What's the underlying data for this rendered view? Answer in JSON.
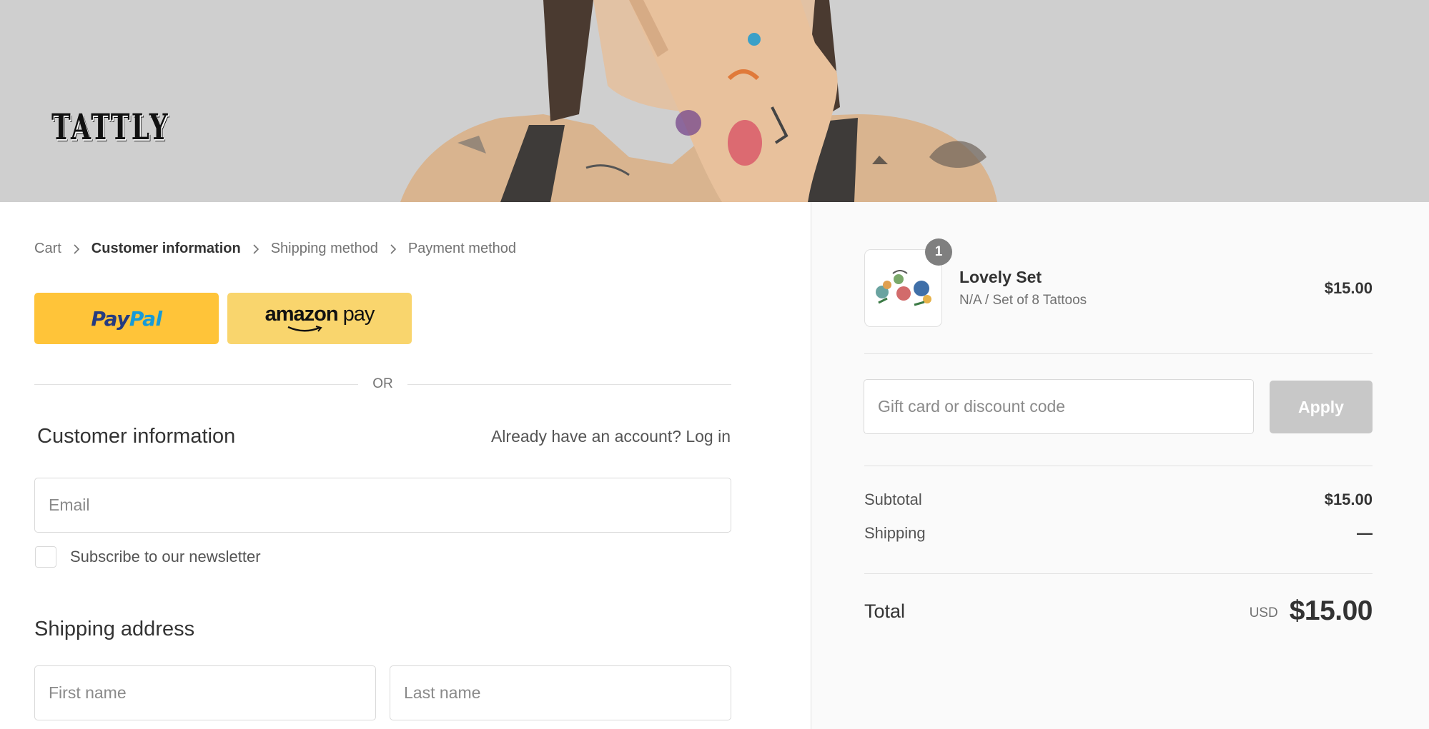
{
  "brand": {
    "logo_text": "TATTLY"
  },
  "breadcrumb": [
    {
      "label": "Cart",
      "current": false
    },
    {
      "label": "Customer information",
      "current": true
    },
    {
      "label": "Shipping method",
      "current": false
    },
    {
      "label": "Payment method",
      "current": false
    }
  ],
  "express_checkout": {
    "paypal": {
      "part1": "Pay",
      "part2": "Pal"
    },
    "amazon": {
      "brand": "amazon",
      "suffix": "pay"
    },
    "divider_text": "OR"
  },
  "customer_info": {
    "title": "Customer information",
    "login_prompt": "Already have an account?",
    "login_link": "Log in",
    "email_placeholder": "Email",
    "newsletter_label": "Subscribe to our newsletter"
  },
  "shipping_address": {
    "title": "Shipping address",
    "first_name_placeholder": "First name",
    "last_name_placeholder": "Last name"
  },
  "order_summary": {
    "item": {
      "quantity": "1",
      "name": "Lovely Set",
      "variant": "N/A / Set of 8 Tattoos",
      "price": "$15.00"
    },
    "discount": {
      "placeholder": "Gift card or discount code",
      "apply_label": "Apply"
    },
    "subtotal": {
      "label": "Subtotal",
      "value": "$15.00"
    },
    "shipping": {
      "label": "Shipping",
      "value": "—"
    },
    "total": {
      "label": "Total",
      "currency": "USD",
      "value": "$15.00"
    }
  },
  "colors": {
    "paypal_yellow": "#ffc439",
    "amazon_yellow": "#f9d56d",
    "apply_disabled": "#c8c8c8",
    "sidebar_bg": "#fafafa",
    "hero_bg": "#cfcfcf"
  },
  "icons": [
    "chevron-right-icon",
    "product-thumbnail"
  ]
}
